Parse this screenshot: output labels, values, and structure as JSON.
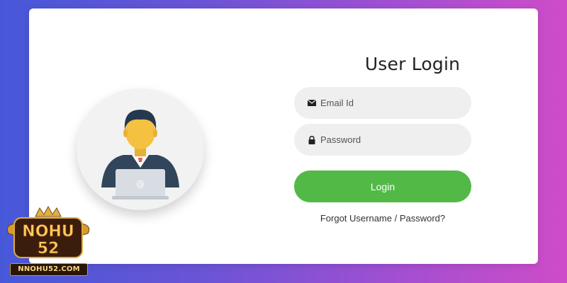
{
  "login": {
    "title": "User Login",
    "email_placeholder": "Email Id",
    "password_placeholder": "Password",
    "button_label": "Login",
    "forgot_link": "Forgot Username / Password?"
  },
  "brand": {
    "logo_text": "NOHU 52",
    "url": "NNOHU52.COM"
  },
  "colors": {
    "accent_green": "#52b947",
    "field_bg": "#efefef",
    "background_gradient": [
      "#4658d8",
      "#cf4cc8"
    ]
  },
  "icons": [
    "envelope-icon",
    "lock-icon",
    "user-avatar-icon",
    "at-sign-icon"
  ]
}
